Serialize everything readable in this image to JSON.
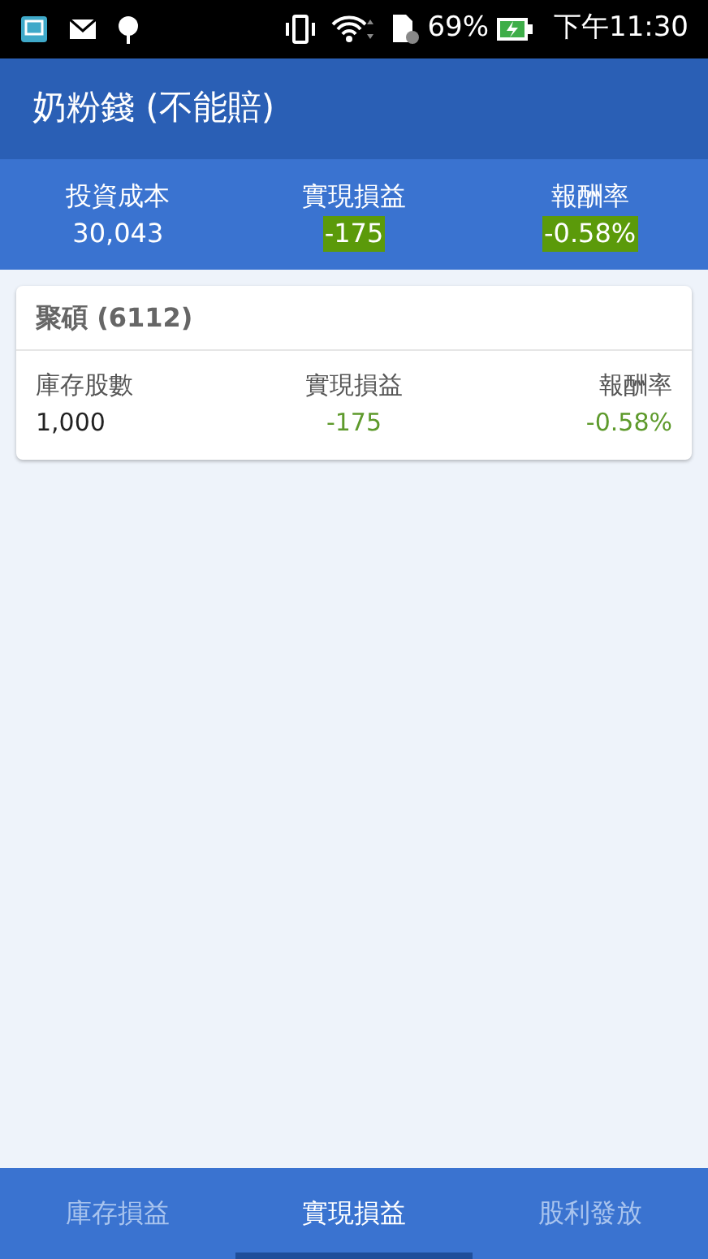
{
  "status_bar": {
    "battery": "69%",
    "time": "下午11:30"
  },
  "app_bar": {
    "title": "奶粉錢 (不能賠)"
  },
  "summary": [
    {
      "label": "投資成本",
      "value": "30,043",
      "highlight": false
    },
    {
      "label": "實現損益",
      "value": "-175",
      "highlight": true
    },
    {
      "label": "報酬率",
      "value": "-0.58%",
      "highlight": true
    }
  ],
  "stocks": [
    {
      "name": "聚碩 (6112)",
      "fields": [
        {
          "label": "庫存股數",
          "value": "1,000",
          "kind": "plain"
        },
        {
          "label": "實現損益",
          "value": "-175",
          "kind": "gain"
        },
        {
          "label": "報酬率",
          "value": "-0.58%",
          "kind": "gain"
        }
      ]
    }
  ],
  "tabs": [
    {
      "label": "庫存損益",
      "selected": false
    },
    {
      "label": "實現損益",
      "selected": true
    },
    {
      "label": "股利發放",
      "selected": false
    }
  ]
}
